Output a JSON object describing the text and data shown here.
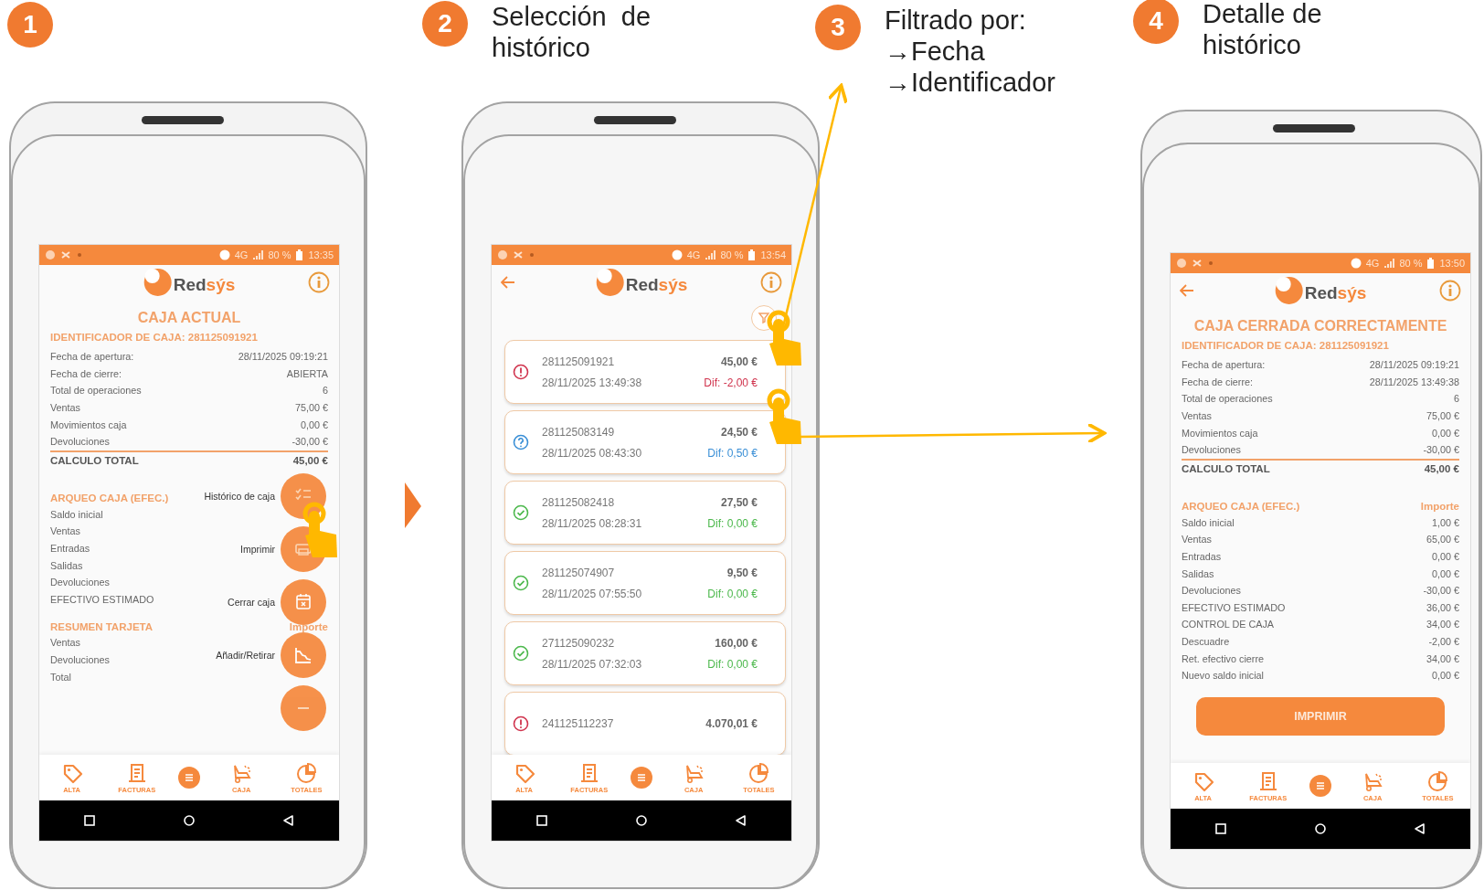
{
  "steps": [
    {
      "number": "1"
    },
    {
      "number": "2",
      "lines": [
        "Selección  de",
        "histórico"
      ]
    },
    {
      "number": "3",
      "lines": [
        "Filtrado por:",
        "→Fecha",
        "→Identificador"
      ]
    },
    {
      "number": "4",
      "lines": [
        "Detalle de",
        "histórico"
      ]
    }
  ],
  "phones": [
    {
      "status_bar": {
        "network": "4G",
        "battery": "80 %",
        "time": "13:35"
      },
      "logo": {
        "prefix": "Red",
        "suffix": "sýs"
      },
      "back": false,
      "screen": {
        "kind": "summary",
        "title": "CAJA ACTUAL",
        "identifier": "IDENTIFICADOR DE CAJA: 281125091921",
        "rows": [
          {
            "label": "Fecha de apertura:",
            "value": "28/11/2025 09:19:21"
          },
          {
            "label": "Fecha de cierre:",
            "value": "ABIERTA"
          },
          {
            "label": "Total de operaciones",
            "value": "6"
          },
          {
            "label": "Ventas",
            "value": "75,00 €"
          },
          {
            "label": "Movimientos caja",
            "value": "0,00 €"
          },
          {
            "label": "Devoluciones",
            "value": "-30,00 €"
          }
        ],
        "total": {
          "label": "CALCULO TOTAL",
          "value": "45,00 €"
        },
        "sections": [
          {
            "title": "ARQUEO CAJA (EFEC.)",
            "rows": [
              {
                "label": "Saldo inicial"
              },
              {
                "label": "Ventas"
              },
              {
                "label": "Entradas"
              },
              {
                "label": "Salidas"
              },
              {
                "label": "Devoluciones"
              },
              {
                "label": "EFECTIVO ESTIMADO"
              }
            ]
          },
          {
            "title": "RESUMEN TARJETA",
            "column": "Importe",
            "rows": [
              {
                "label": "Ventas"
              },
              {
                "label": "Devoluciones"
              },
              {
                "label": "Total"
              }
            ]
          }
        ],
        "fab_menu": [
          {
            "label": "Histórico de caja"
          },
          {
            "label": "Imprimir"
          },
          {
            "label": "Cerrar caja"
          },
          {
            "label": "Añadir/Retirar"
          }
        ]
      },
      "nav": [
        {
          "label": "ALTA"
        },
        {
          "label": "FACTURAS"
        },
        {
          "label": "CAJA"
        },
        {
          "label": "TOTALES"
        }
      ]
    },
    {
      "status_bar": {
        "network": "4G",
        "battery": "80 %",
        "time": "13:54"
      },
      "logo": {
        "prefix": "Red",
        "suffix": "sýs"
      },
      "back": true,
      "screen": {
        "kind": "history",
        "entries": [
          {
            "id": "281125091921",
            "datetime": "28/11/2025 13:49:38",
            "amount": "45,00 €",
            "difference": "Dif: -2,00 €",
            "kind": "error"
          },
          {
            "id": "281125083149",
            "datetime": "28/11/2025 08:43:30",
            "amount": "24,50 €",
            "difference": "Dif: 0,50 €",
            "kind": "warning"
          },
          {
            "id": "281125082418",
            "datetime": "28/11/2025 08:28:31",
            "amount": "27,50 €",
            "difference": "Dif: 0,00 €",
            "kind": "ok"
          },
          {
            "id": "281125074907",
            "datetime": "28/11/2025 07:55:50",
            "amount": "9,50 €",
            "difference": "Dif: 0,00 €",
            "kind": "ok"
          },
          {
            "id": "271125090232",
            "datetime": "28/11/2025 07:32:03",
            "amount": "160,00 €",
            "difference": "Dif: 0,00 €",
            "kind": "ok"
          },
          {
            "id": "241125112237",
            "amount": "4.070,01 €",
            "kind": "error"
          }
        ]
      },
      "nav": [
        {
          "label": "ALTA"
        },
        {
          "label": "FACTURAS"
        },
        {
          "label": "CAJA"
        },
        {
          "label": "TOTALES"
        }
      ]
    },
    {
      "status_bar": {
        "network": "4G",
        "battery": "80 %",
        "time": "13:50"
      },
      "logo": {
        "prefix": "Red",
        "suffix": "sýs"
      },
      "back": true,
      "screen": {
        "kind": "detail",
        "title": "CAJA CERRADA CORRECTAMENTE",
        "identifier": "IDENTIFICADOR DE CAJA: 281125091921",
        "rows": [
          {
            "label": "Fecha de apertura:",
            "value": "28/11/2025 09:19:21"
          },
          {
            "label": "Fecha de cierre:",
            "value": "28/11/2025 13:49:38"
          },
          {
            "label": "Total de operaciones",
            "value": "6"
          },
          {
            "label": "Ventas",
            "value": "75,00 €"
          },
          {
            "label": "Movimientos caja",
            "value": "0,00 €"
          },
          {
            "label": "Devoluciones",
            "value": "-30,00 €"
          }
        ],
        "total": {
          "label": "CALCULO TOTAL",
          "value": "45,00 €"
        },
        "sections": [
          {
            "title": "ARQUEO CAJA (EFEC.)",
            "column": "Importe",
            "rows": [
              {
                "label": "Saldo inicial",
                "value": "1,00 €"
              },
              {
                "label": "Ventas",
                "value": "65,00 €"
              },
              {
                "label": "Entradas",
                "value": "0,00 €"
              },
              {
                "label": "Salidas",
                "value": "0,00 €"
              },
              {
                "label": "Devoluciones",
                "value": "-30,00 €"
              },
              {
                "label": "EFECTIVO ESTIMADO",
                "value": "36,00 €"
              },
              {
                "label": "CONTROL DE CAJA",
                "value": "34,00 €"
              },
              {
                "label": "Descuadre",
                "value": "-2,00 €"
              },
              {
                "label": "Ret. efectivo cierre",
                "value": "34,00 €"
              },
              {
                "label": "Nuevo saldo inicial",
                "value": "0,00 €"
              }
            ]
          }
        ],
        "button": "IMPRIMIR"
      },
      "nav": [
        {
          "label": "ALTA"
        },
        {
          "label": "FACTURAS"
        },
        {
          "label": "CAJA"
        },
        {
          "label": "TOTALES"
        }
      ]
    }
  ]
}
